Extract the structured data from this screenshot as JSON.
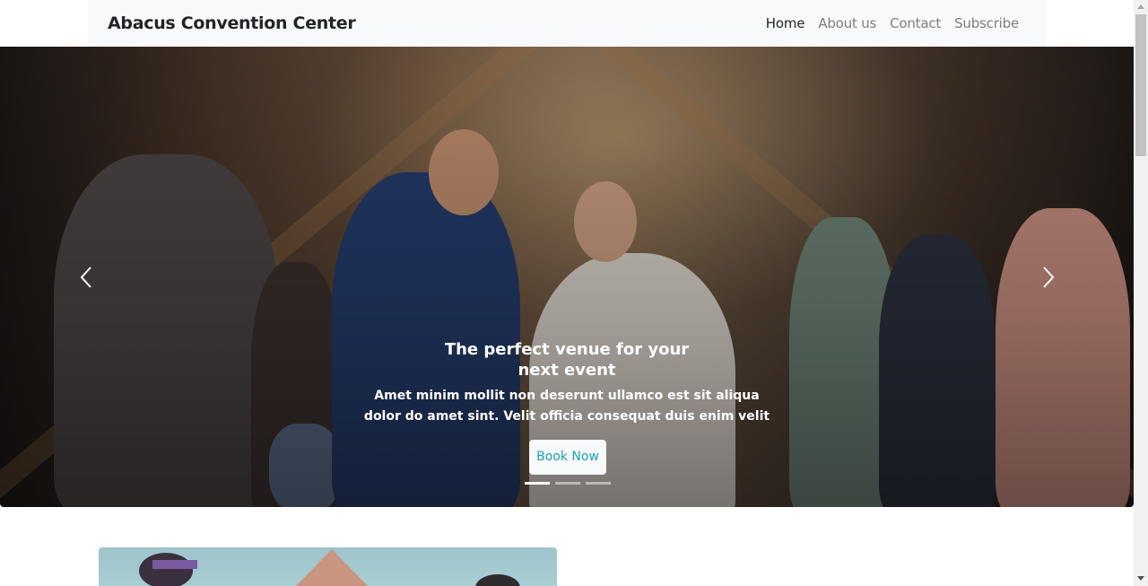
{
  "navbar": {
    "brand": "Abacus Convention Center",
    "links": [
      {
        "label": "Home",
        "active": true
      },
      {
        "label": "About us",
        "active": false
      },
      {
        "label": "Contact",
        "active": false
      },
      {
        "label": "Subscribe",
        "active": false
      }
    ]
  },
  "carousel": {
    "title_line1": "The perfect venue for your",
    "title_line2": "next event",
    "text_line1": "Amet minim mollit non deserunt ullamco est sit aliqua",
    "text_line2": "dolor do amet sint. Velit officia consequat duis enim velit",
    "button_label": "Book Now",
    "prev_icon": "chevron-left-icon",
    "next_icon": "chevron-right-icon",
    "slides_count": 3,
    "active_slide": 1
  },
  "colors": {
    "navbar_bg": "#f8f9fa",
    "button_text": "#17a2b8"
  }
}
